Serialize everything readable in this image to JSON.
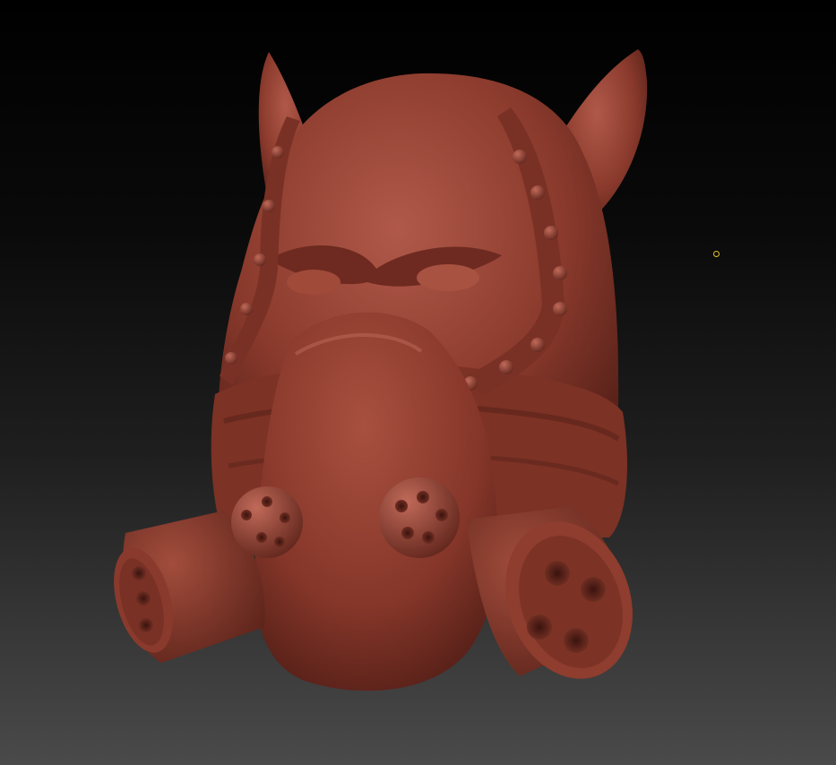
{
  "viewport": {
    "background_top": "#000000",
    "background_bottom": "#4a4a4a"
  },
  "model": {
    "subject": "sculpted-head-with-gas-mask",
    "material_color": "#8a3a2c",
    "highlight_color": "#b0594a",
    "shadow_color": "#4a1a14"
  },
  "cursor": {
    "color": "#e8c21a",
    "icon": "brush-cursor-icon"
  }
}
